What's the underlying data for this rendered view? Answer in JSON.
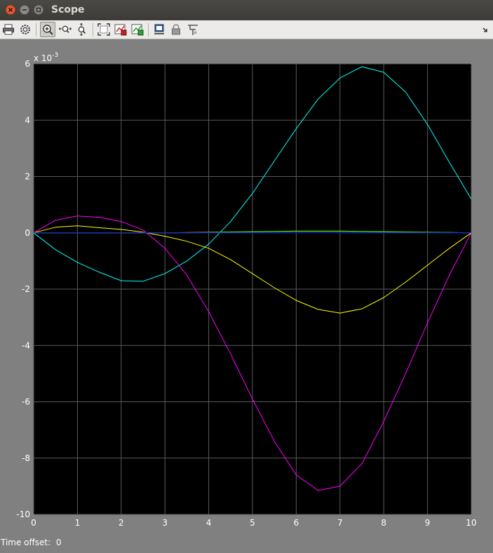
{
  "window": {
    "title": "Scope"
  },
  "toolbar": {
    "buttons": [
      {
        "name": "print-icon",
        "active": false
      },
      {
        "name": "parameters-icon",
        "active": false
      },
      {
        "name": "zoom-in-icon",
        "active": true
      },
      {
        "name": "zoom-x-icon",
        "active": false
      },
      {
        "name": "zoom-y-icon",
        "active": false
      },
      {
        "name": "autoscale-icon",
        "active": false
      },
      {
        "name": "save-axes-settings-icon",
        "active": false
      },
      {
        "name": "restore-axes-settings-icon",
        "active": false
      },
      {
        "name": "floating-scope-icon",
        "active": false
      },
      {
        "name": "lock-axes-icon",
        "active": false
      },
      {
        "name": "signal-selection-icon",
        "active": false
      }
    ],
    "dock_icon": "dock-arrow-icon"
  },
  "chart_data": {
    "type": "line",
    "title": "",
    "xlabel": "",
    "ylabel": "",
    "xlim": [
      0,
      10
    ],
    "ylim": [
      -10,
      6
    ],
    "xticks": [
      0,
      1,
      2,
      3,
      4,
      5,
      6,
      7,
      8,
      9,
      10
    ],
    "yticks": [
      -10,
      -8,
      -6,
      -4,
      -2,
      0,
      2,
      4,
      6
    ],
    "y_exponent_label": "x 10",
    "y_exponent_value": "-3",
    "grid": true,
    "background": "#000000",
    "series": [
      {
        "color": "#00ffff",
        "x": [
          0,
          0.5,
          1,
          1.5,
          2,
          2.5,
          3,
          3.5,
          4,
          4.5,
          5,
          5.5,
          6,
          6.5,
          7,
          7.5,
          8,
          8.5,
          9,
          9.5,
          10
        ],
        "values": [
          0,
          -0.6,
          -1.05,
          -1.4,
          -1.7,
          -1.72,
          -1.45,
          -1.0,
          -0.4,
          0.4,
          1.4,
          2.55,
          3.7,
          4.75,
          5.5,
          5.9,
          5.7,
          5.0,
          3.85,
          2.5,
          1.2
        ]
      },
      {
        "color": "#ff00ff",
        "x": [
          0,
          0.5,
          1,
          1.5,
          2,
          2.5,
          3,
          3.5,
          4,
          4.5,
          5,
          5.5,
          6,
          6.5,
          7,
          7.5,
          8,
          8.5,
          9,
          9.5,
          10
        ],
        "values": [
          0,
          0.45,
          0.6,
          0.55,
          0.4,
          0.1,
          -0.55,
          -1.5,
          -2.8,
          -4.3,
          -5.9,
          -7.4,
          -8.6,
          -9.15,
          -9.0,
          -8.2,
          -6.7,
          -5.0,
          -3.2,
          -1.5,
          0
        ]
      },
      {
        "color": "#ffff00",
        "x": [
          0,
          0.5,
          1,
          1.5,
          2,
          2.5,
          3,
          3.5,
          4,
          4.5,
          5,
          5.5,
          6,
          6.5,
          7,
          7.5,
          8,
          8.5,
          9,
          9.5,
          10
        ],
        "values": [
          0,
          0.2,
          0.25,
          0.18,
          0.12,
          0.02,
          -0.12,
          -0.3,
          -0.55,
          -0.95,
          -1.45,
          -1.95,
          -2.4,
          -2.72,
          -2.85,
          -2.7,
          -2.3,
          -1.75,
          -1.15,
          -0.55,
          0
        ]
      },
      {
        "color": "#f0a030",
        "x": [
          0,
          0.5,
          1,
          1.5,
          2,
          2.5,
          3,
          3.5,
          4,
          4.5,
          5,
          5.5,
          6,
          6.5,
          7,
          7.5,
          8,
          8.5,
          9,
          9.5,
          10
        ],
        "values": [
          0,
          0,
          0,
          0,
          0,
          0,
          0,
          0.01,
          0.02,
          0.03,
          0.04,
          0.05,
          0.06,
          0.06,
          0.06,
          0.05,
          0.04,
          0.03,
          0.02,
          0.01,
          0
        ]
      },
      {
        "color": "#00ff00",
        "x": [
          0,
          0.5,
          1,
          1.5,
          2,
          2.5,
          3,
          3.5,
          4,
          4.5,
          5,
          5.5,
          6,
          6.5,
          7,
          7.5,
          8,
          8.5,
          9,
          9.5,
          10
        ],
        "values": [
          0,
          0,
          0,
          0,
          0,
          0,
          0,
          0,
          0.01,
          0.02,
          0.03,
          0.04,
          0.05,
          0.05,
          0.05,
          0.04,
          0.03,
          0.02,
          0.01,
          0.01,
          0
        ]
      },
      {
        "color": "#0000ff",
        "x": [
          0,
          10
        ],
        "values": [
          0,
          0
        ]
      }
    ]
  },
  "footer": {
    "label": "Time offset:",
    "value": "0"
  }
}
